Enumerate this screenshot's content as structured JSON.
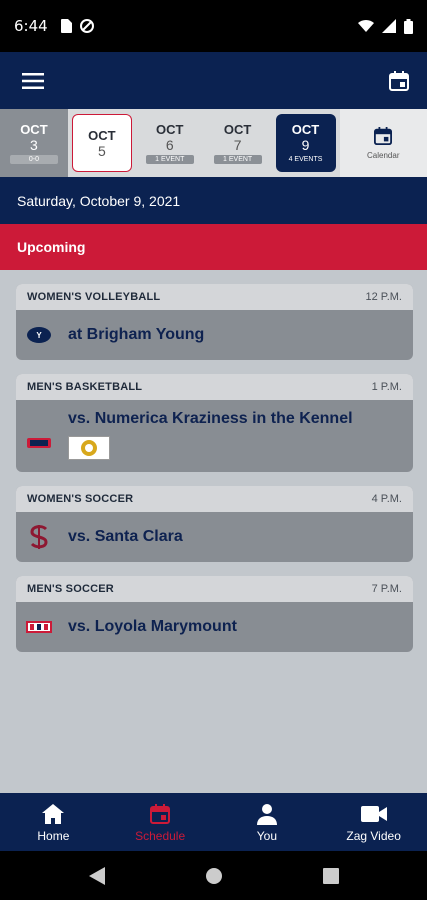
{
  "status_bar": {
    "time": "6:44"
  },
  "dates": [
    {
      "month": "OCT",
      "day": "3",
      "tag": "0-0",
      "state": "past"
    },
    {
      "month": "OCT",
      "day": "5",
      "tag": "",
      "state": "today"
    },
    {
      "month": "OCT",
      "day": "6",
      "tag": "1 EVENT",
      "state": "normal"
    },
    {
      "month": "OCT",
      "day": "7",
      "tag": "1 EVENT",
      "state": "normal"
    },
    {
      "month": "OCT",
      "day": "9",
      "tag": "4 EVENTS",
      "state": "selected"
    }
  ],
  "calendar_label": "Calendar",
  "date_header": "Saturday, October 9, 2021",
  "section_title": "Upcoming",
  "events": [
    {
      "sport": "WOMEN'S VOLLEYBALL",
      "time": "12 P.M.",
      "opponent": "at Brigham Young"
    },
    {
      "sport": "MEN'S BASKETBALL",
      "time": "1 P.M.",
      "opponent": "vs. Numerica Kraziness in the Kennel"
    },
    {
      "sport": "WOMEN'S SOCCER",
      "time": "4 P.M.",
      "opponent": "vs. Santa Clara"
    },
    {
      "sport": "MEN'S SOCCER",
      "time": "7 P.M.",
      "opponent": "vs. Loyola Marymount"
    }
  ],
  "bottom_nav": {
    "home": "Home",
    "schedule": "Schedule",
    "you": "You",
    "video": "Zag Video"
  },
  "colors": {
    "navy": "#0b2251",
    "red": "#cc1a38"
  }
}
